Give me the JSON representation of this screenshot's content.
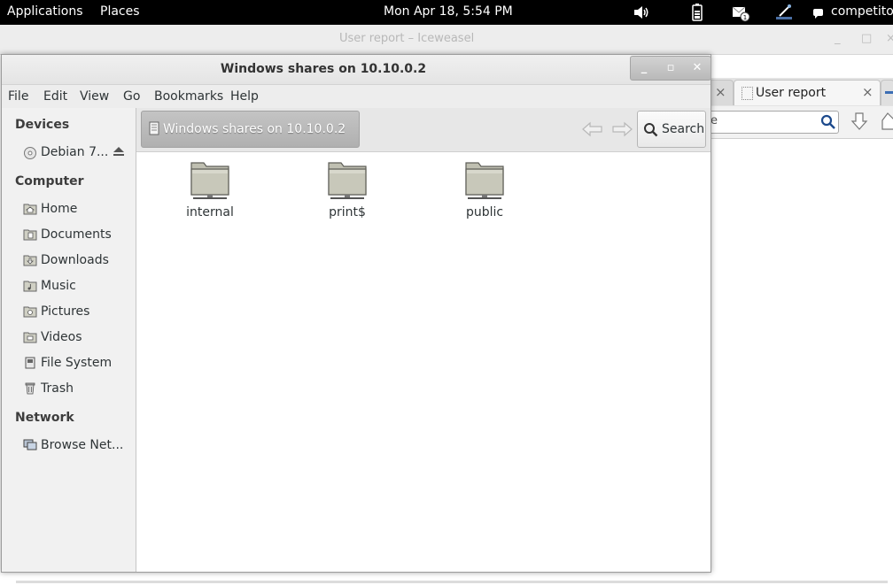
{
  "top_panel": {
    "applications": "Applications",
    "places": "Places",
    "clock": "Mon Apr 18,  5:54 PM",
    "user": "competito"
  },
  "background_window": {
    "title": "User report – Iceweasel",
    "active_tab": "User report",
    "url_fragment": "e"
  },
  "nautilus": {
    "title": "Windows shares on 10.10.0.2",
    "menu": [
      "File",
      "Edit",
      "View",
      "Go",
      "Bookmarks",
      "Help"
    ],
    "sidebar": {
      "devices_heading": "Devices",
      "devices": [
        {
          "label": "Debian 7...",
          "icon": "disc-icon"
        }
      ],
      "computer_heading": "Computer",
      "computer": [
        {
          "label": "Home",
          "icon": "home-folder-icon"
        },
        {
          "label": "Documents",
          "icon": "documents-folder-icon"
        },
        {
          "label": "Downloads",
          "icon": "downloads-folder-icon"
        },
        {
          "label": "Music",
          "icon": "music-folder-icon"
        },
        {
          "label": "Pictures",
          "icon": "pictures-folder-icon"
        },
        {
          "label": "Videos",
          "icon": "videos-folder-icon"
        },
        {
          "label": "File System",
          "icon": "harddisk-icon"
        },
        {
          "label": "Trash",
          "icon": "trash-icon"
        }
      ],
      "network_heading": "Network",
      "network": [
        {
          "label": "Browse Net...",
          "icon": "network-icon"
        }
      ]
    },
    "path_button": "Windows shares on 10.10.0.2",
    "search_label": "Search",
    "files": [
      {
        "name": "internal",
        "icon": "network-share-folder-icon"
      },
      {
        "name": "print$",
        "icon": "network-share-folder-icon"
      },
      {
        "name": "public",
        "icon": "network-share-folder-icon"
      }
    ]
  }
}
